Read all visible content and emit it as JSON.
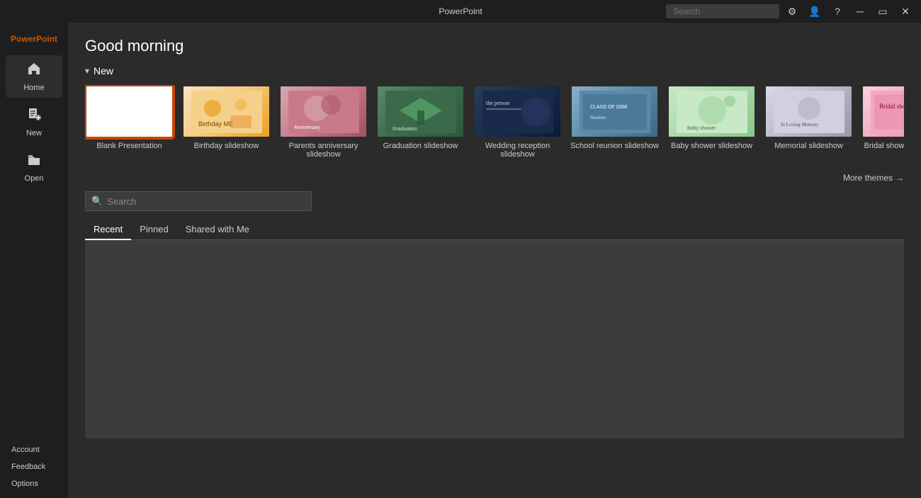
{
  "titlebar": {
    "app_name": "PowerPoint",
    "search_placeholder": "Search",
    "controls": {
      "settings_label": "⚙",
      "account_label": "👤",
      "help_label": "?",
      "minimize_label": "─",
      "restore_label": "▭",
      "close_label": "✕"
    }
  },
  "sidebar": {
    "brand": "PowerPoint",
    "items": [
      {
        "id": "home",
        "label": "Home",
        "icon": "🏠"
      },
      {
        "id": "new",
        "label": "New",
        "icon": "📄"
      },
      {
        "id": "open",
        "label": "Open",
        "icon": "📂"
      }
    ],
    "bottom_items": [
      {
        "id": "account",
        "label": "Account"
      },
      {
        "id": "feedback",
        "label": "Feedback"
      },
      {
        "id": "options",
        "label": "Options"
      }
    ]
  },
  "content": {
    "greeting": "Good morning",
    "new_section": {
      "title": "New",
      "toggle": "▾"
    },
    "templates": [
      {
        "id": "blank",
        "label": "Blank Presentation",
        "type": "blank",
        "selected": true
      },
      {
        "id": "birthday",
        "label": "Birthday slideshow",
        "type": "birthday"
      },
      {
        "id": "anniversary",
        "label": "Parents anniversary slideshow",
        "type": "anniversary"
      },
      {
        "id": "graduation",
        "label": "Graduation slideshow",
        "type": "graduation"
      },
      {
        "id": "wedding",
        "label": "Wedding reception slideshow",
        "type": "wedding"
      },
      {
        "id": "reunion",
        "label": "School reunion slideshow",
        "type": "reunion"
      },
      {
        "id": "baby",
        "label": "Baby shower slideshow",
        "type": "baby"
      },
      {
        "id": "memorial",
        "label": "Memorial slideshow",
        "type": "memorial"
      },
      {
        "id": "bridal",
        "label": "Bridal shower slideshow",
        "type": "bridal"
      }
    ],
    "more_themes_label": "More themes",
    "search": {
      "placeholder": "Search"
    },
    "tabs": [
      {
        "id": "recent",
        "label": "Recent",
        "active": true
      },
      {
        "id": "pinned",
        "label": "Pinned",
        "active": false
      },
      {
        "id": "shared",
        "label": "Shared with Me",
        "active": false
      }
    ]
  }
}
